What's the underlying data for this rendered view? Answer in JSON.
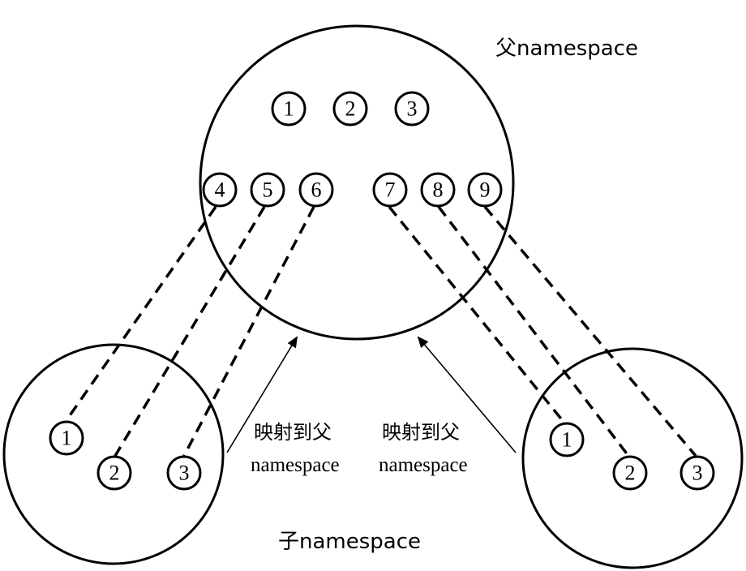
{
  "parent_namespace": {
    "label": "父namespace",
    "top_row": [
      "1",
      "2",
      "3"
    ],
    "bottom_row": [
      "4",
      "5",
      "6",
      "7",
      "8",
      "9"
    ]
  },
  "child_namespace_left": {
    "label": "子namespace",
    "nodes": [
      "1",
      "2",
      "3"
    ],
    "mapping_label_line1": "映射到父",
    "mapping_label_line2": "namespace"
  },
  "child_namespace_right": {
    "nodes": [
      "1",
      "2",
      "3"
    ],
    "mapping_label_line1": "映射到父",
    "mapping_label_line2": "namespace"
  }
}
